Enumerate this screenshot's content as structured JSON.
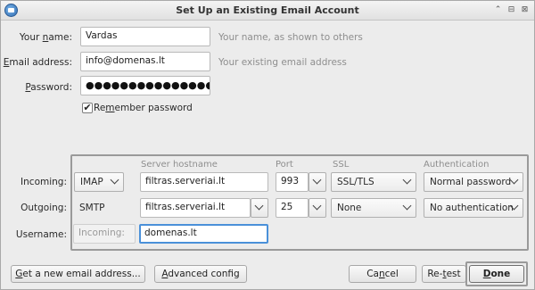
{
  "window": {
    "title": "Set Up an Existing Email Account",
    "controls": [
      "⌃",
      "⊟",
      "⊠"
    ]
  },
  "form": {
    "name": {
      "label_pre": "Your ",
      "label_key": "n",
      "label_post": "ame:",
      "value": "Vardas",
      "hint": "Your name, as shown to others"
    },
    "email": {
      "label_pre": "",
      "label_key": "E",
      "label_post": "mail address:",
      "value": "info@domenas.lt",
      "hint": "Your existing email address"
    },
    "password": {
      "label_pre": "",
      "label_key": "P",
      "label_post": "assword:",
      "value": "●●●●●●●●●●●●●●●●"
    },
    "remember": {
      "label_pre": "Re",
      "label_key": "m",
      "label_post": "ember password",
      "checked": true,
      "mark": "✔"
    }
  },
  "server": {
    "headers": {
      "hostname": "Server hostname",
      "port": "Port",
      "ssl": "SSL",
      "auth": "Authentication"
    },
    "incoming": {
      "label": "Incoming:",
      "protocol": "IMAP",
      "hostname": "filtras.serveriai.lt",
      "port": "993",
      "ssl": "SSL/TLS",
      "auth": "Normal password"
    },
    "outgoing": {
      "label": "Outgoing:",
      "protocol": "SMTP",
      "hostname": "filtras.serveriai.lt",
      "port": "25",
      "ssl": "None",
      "auth": "No authentication"
    },
    "username": {
      "label": "Username:",
      "incoming_placeholder": "Incoming:",
      "value": "domenas.lt"
    }
  },
  "buttons": {
    "new_email": {
      "key": "G",
      "rest": "et a new email address..."
    },
    "advanced": {
      "key": "A",
      "rest": "dvanced config"
    },
    "cancel": {
      "pre": "Ca",
      "key": "n",
      "rest": "cel"
    },
    "retest": {
      "pre": "Re-",
      "key": "t",
      "rest": "est"
    },
    "done": {
      "pre": "",
      "key": "D",
      "rest": "one"
    }
  }
}
